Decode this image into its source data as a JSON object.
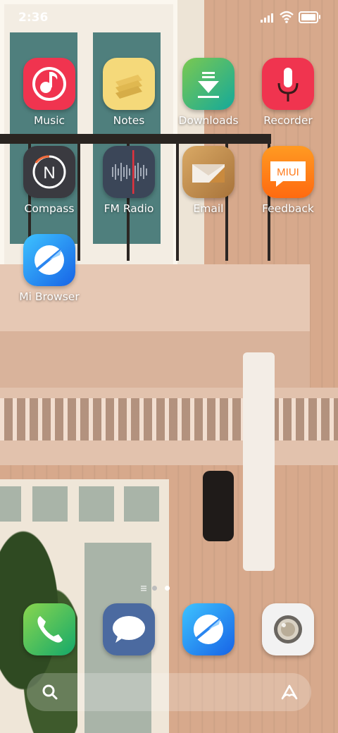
{
  "status_bar": {
    "time": "2:36"
  },
  "home": {
    "apps": [
      {
        "label": "Music",
        "icon": "music-icon"
      },
      {
        "label": "Notes",
        "icon": "notes-icon"
      },
      {
        "label": "Downloads",
        "icon": "downloads-icon"
      },
      {
        "label": "Recorder",
        "icon": "recorder-icon"
      },
      {
        "label": "Compass",
        "icon": "compass-icon"
      },
      {
        "label": "FM Radio",
        "icon": "fm-radio-icon"
      },
      {
        "label": "Email",
        "icon": "email-icon"
      },
      {
        "label": "Feedback",
        "icon": "feedback-icon",
        "badge_text": "MIUI"
      },
      {
        "label": "Mi Browser",
        "icon": "browser-icon"
      }
    ],
    "compass_letter": "N",
    "page_indicator": {
      "pages": 2,
      "current": 2
    }
  },
  "dock": {
    "apps": [
      {
        "icon": "phone-icon"
      },
      {
        "icon": "messages-icon"
      },
      {
        "icon": "browser-icon"
      },
      {
        "icon": "camera-icon"
      }
    ]
  },
  "colors": {
    "music": "#f0344f",
    "notes": "#f5d97a",
    "downloads": "#2fbf8f",
    "recorder": "#f0344f",
    "compass": "#3a3a40",
    "fm": "#3b4658",
    "email": "#c9924e",
    "feedback": "#ff7a1a",
    "browser": "#1e9bf0",
    "phone": "#3cc274",
    "messages": "#4b6aa0",
    "camera": "#f2f2f2",
    "dot_active": "#ffffff",
    "dot_inactive": "#bdbdbd"
  }
}
